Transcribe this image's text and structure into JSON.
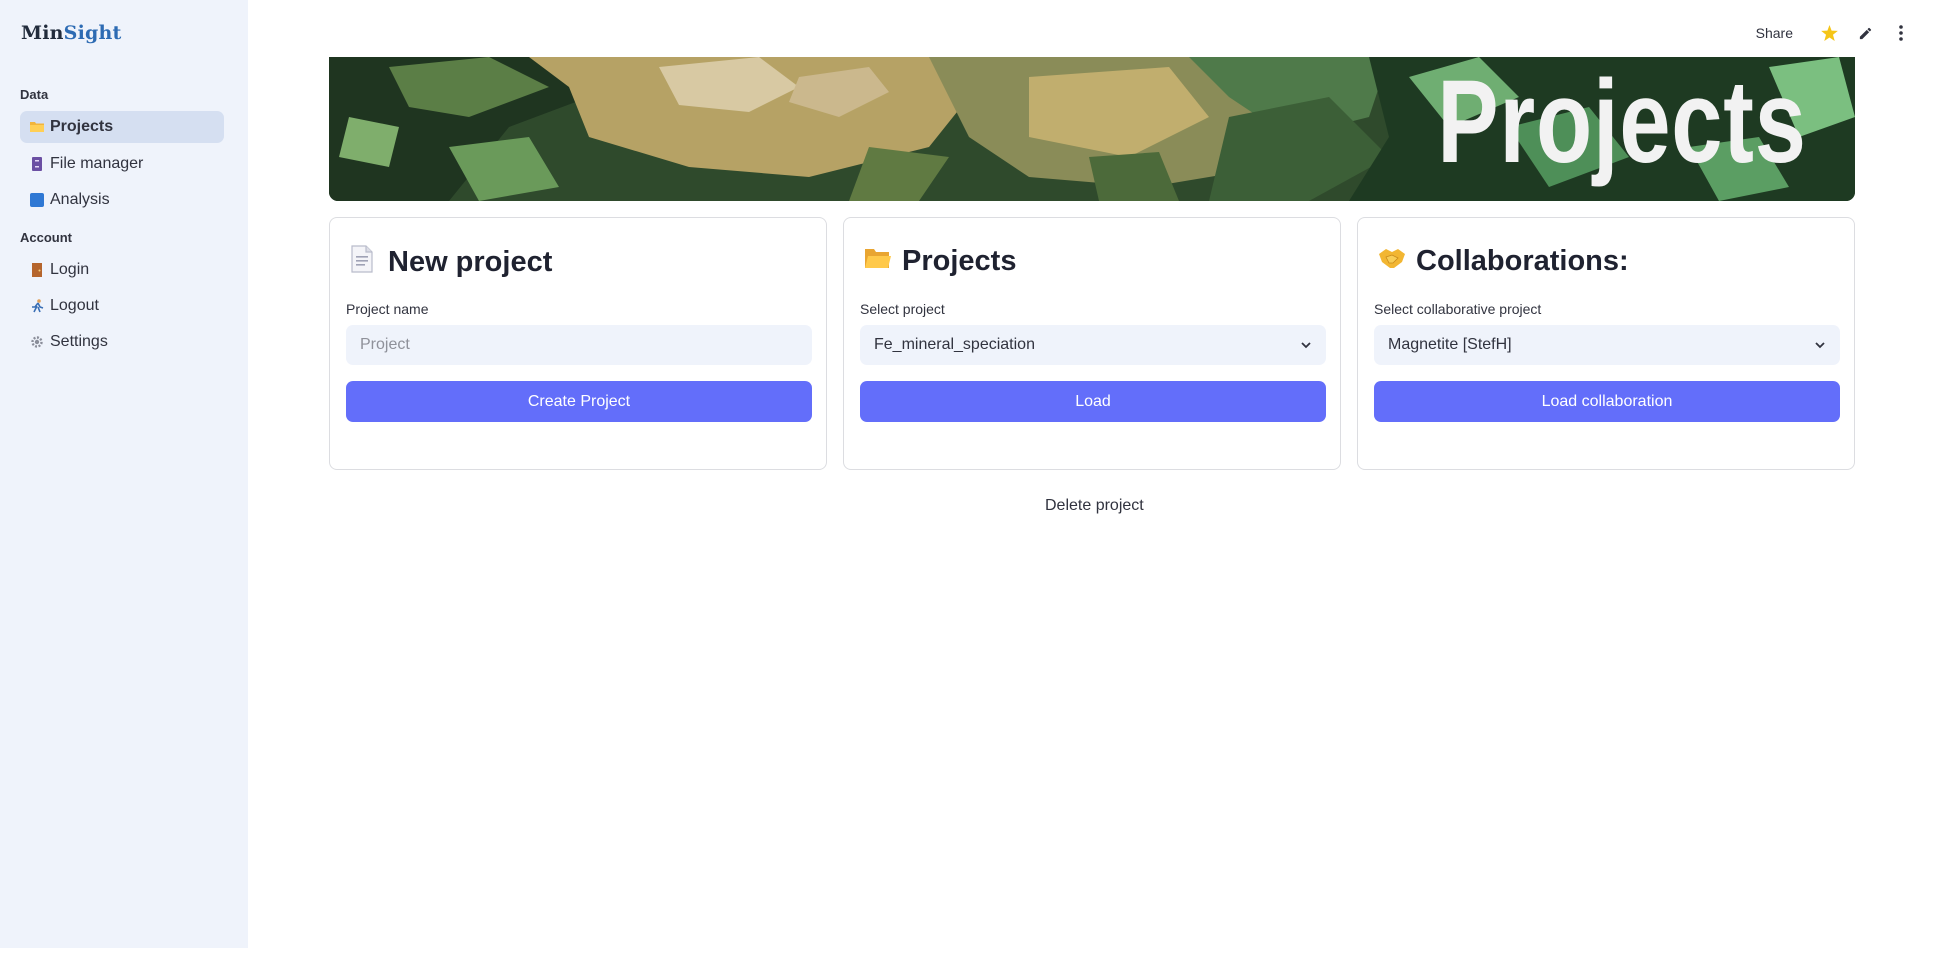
{
  "app": {
    "logo_part1": "Min",
    "logo_part2": "Sight"
  },
  "sidebar": {
    "sections": [
      {
        "title": "Data",
        "items": [
          {
            "label": "Projects",
            "icon": "folder-icon",
            "active": true
          },
          {
            "label": "File manager",
            "icon": "file-cabinet-icon",
            "active": false
          },
          {
            "label": "Analysis",
            "icon": "blue-square-icon",
            "active": false
          }
        ]
      },
      {
        "title": "Account",
        "items": [
          {
            "label": "Login",
            "icon": "door-icon",
            "active": false
          },
          {
            "label": "Logout",
            "icon": "runner-icon",
            "active": false
          },
          {
            "label": "Settings",
            "icon": "gear-icon",
            "active": false
          }
        ]
      }
    ]
  },
  "topbar": {
    "share_label": "Share",
    "icons": [
      "star-icon",
      "edit-icon",
      "more-vertical-icon"
    ],
    "star_color": "#f5c518"
  },
  "banner": {
    "title": "Projects"
  },
  "cards": {
    "new_project": {
      "title": "New project",
      "icon": "page-icon",
      "label": "Project name",
      "placeholder": "Project",
      "button": "Create Project"
    },
    "projects": {
      "title": "Projects",
      "icon": "open-folder-icon",
      "label": "Select project",
      "selected": "Fe_mineral_speciation",
      "button": "Load"
    },
    "collaborations": {
      "title": "Collaborations:",
      "icon": "handshake-icon",
      "label": "Select collaborative project",
      "selected": "Magnetite [StefH]",
      "button": "Load collaboration"
    }
  },
  "delete_label": "Delete project",
  "colors": {
    "accent": "#636efa",
    "sidebar_bg": "#eff3fb",
    "active_item_bg": "#d5dff1"
  }
}
